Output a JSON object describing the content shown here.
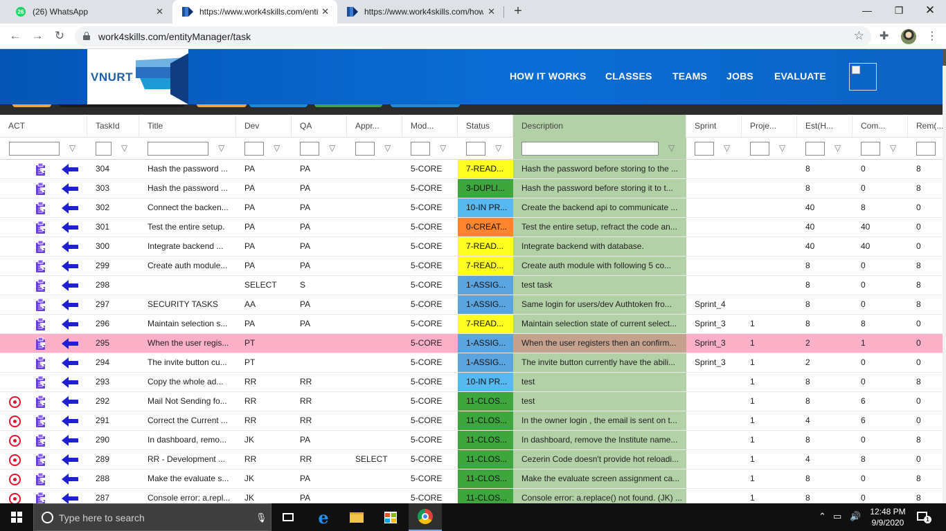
{
  "browser": {
    "tabs": [
      {
        "title": "(26) WhatsApp",
        "badge": "26",
        "icon": "whatsapp-icon",
        "active": false
      },
      {
        "title": "https://www.work4skills.com/entit",
        "icon": "work4skills-icon",
        "active": true
      },
      {
        "title": "https://www.work4skills.com/how",
        "icon": "work4skills-icon",
        "active": false
      }
    ],
    "url": "work4skills.com/entityManager/task"
  },
  "site": {
    "logo_text": "VNURT",
    "nav": [
      "HOW IT WORKS",
      "CLASSES",
      "TEAMS",
      "JOBS",
      "EVALUATE"
    ]
  },
  "grid": {
    "columns": [
      "ACT",
      "TaskId",
      "Title",
      "Dev",
      "QA",
      "Appr...",
      "Mod...",
      "Status",
      "Description",
      "Sprint",
      "Proje...",
      "Est(H...",
      "Com...",
      "Rem(..."
    ],
    "rows": [
      {
        "red": false,
        "id": "304",
        "title": "Hash the password ...",
        "dev": "PA",
        "qa": "PA",
        "appr": "",
        "mod": "5-CORE",
        "status": "7-READ...",
        "status_color": "#ffff22",
        "desc": "Hash the password before storing to the ...",
        "sprint": "",
        "proj": "",
        "est": "8",
        "com": "0",
        "rem": "8"
      },
      {
        "red": false,
        "id": "303",
        "title": "Hash the password ...",
        "dev": "PA",
        "qa": "PA",
        "appr": "",
        "mod": "5-CORE",
        "status": "3-DUPLI...",
        "status_color": "#3da63d",
        "desc": "Hash the password before storing it to t...",
        "sprint": "",
        "proj": "",
        "est": "8",
        "com": "0",
        "rem": "8"
      },
      {
        "red": false,
        "id": "302",
        "title": "Connect the backen...",
        "dev": "PA",
        "qa": "PA",
        "appr": "",
        "mod": "5-CORE",
        "status": "10-IN PR...",
        "status_color": "#56b9f0",
        "desc": "Create the backend api to communicate ...",
        "sprint": "",
        "proj": "",
        "est": "40",
        "com": "8",
        "rem": "0"
      },
      {
        "red": false,
        "id": "301",
        "title": "Test the entire setup.",
        "dev": "PA",
        "qa": "PA",
        "appr": "",
        "mod": "5-CORE",
        "status": "0-CREAT...",
        "status_color": "#ff8630",
        "desc": "Test the entire setup, refract the code an...",
        "sprint": "",
        "proj": "",
        "est": "40",
        "com": "40",
        "rem": "0"
      },
      {
        "red": false,
        "id": "300",
        "title": "Integrate backend ...",
        "dev": "PA",
        "qa": "PA",
        "appr": "",
        "mod": "5-CORE",
        "status": "7-READ...",
        "status_color": "#ffff22",
        "desc": "Integrate backend with database.",
        "sprint": "",
        "proj": "",
        "est": "40",
        "com": "40",
        "rem": "0"
      },
      {
        "red": false,
        "id": "299",
        "title": "Create auth module...",
        "dev": "PA",
        "qa": "PA",
        "appr": "",
        "mod": "5-CORE",
        "status": "7-READ...",
        "status_color": "#ffff22",
        "desc": "Create auth module with following 5 co...",
        "sprint": "",
        "proj": "",
        "est": "8",
        "com": "0",
        "rem": "8"
      },
      {
        "red": false,
        "id": "298",
        "title": "",
        "dev": "SELECT",
        "qa": "S",
        "appr": "",
        "mod": "5-CORE",
        "status": "1-ASSIG...",
        "status_color": "#5aa4e0",
        "desc": "test task",
        "sprint": "",
        "proj": "",
        "est": "8",
        "com": "0",
        "rem": "8"
      },
      {
        "red": false,
        "id": "297",
        "title": "SECURITY TASKS",
        "dev": "AA",
        "qa": "PA",
        "appr": "",
        "mod": "5-CORE",
        "status": "1-ASSIG...",
        "status_color": "#5aa4e0",
        "desc": "Same login for users/dev Authtoken fro...",
        "sprint": "Sprint_4",
        "proj": "",
        "est": "8",
        "com": "0",
        "rem": "8"
      },
      {
        "red": false,
        "id": "296",
        "title": "Maintain selection s...",
        "dev": "PA",
        "qa": "PA",
        "appr": "",
        "mod": "5-CORE",
        "status": "7-READ...",
        "status_color": "#ffff22",
        "desc": "Maintain selection state of current select...",
        "sprint": "Sprint_3",
        "proj": "1",
        "est": "8",
        "com": "8",
        "rem": "0"
      },
      {
        "red": false,
        "selected": true,
        "id": "295",
        "title": "When the user regis...",
        "dev": "PT",
        "qa": "",
        "appr": "",
        "mod": "5-CORE",
        "status": "1-ASSIG...",
        "status_color": "#5aa4e0",
        "desc": "When the user registers then an confirm...",
        "sprint": "Sprint_3",
        "proj": "1",
        "est": "2",
        "com": "1",
        "rem": "0"
      },
      {
        "red": false,
        "id": "294",
        "title": "The invite button cu...",
        "dev": "PT",
        "qa": "",
        "appr": "",
        "mod": "5-CORE",
        "status": "1-ASSIG...",
        "status_color": "#5aa4e0",
        "desc": "The invite button currently have the abili...",
        "sprint": "Sprint_3",
        "proj": "1",
        "est": "2",
        "com": "0",
        "rem": "0"
      },
      {
        "red": false,
        "id": "293",
        "title": "Copy the whole ad...",
        "dev": "RR",
        "qa": "RR",
        "appr": "",
        "mod": "5-CORE",
        "status": "10-IN PR...",
        "status_color": "#56b9f0",
        "desc": "test",
        "sprint": "",
        "proj": "1",
        "est": "8",
        "com": "0",
        "rem": "8"
      },
      {
        "red": true,
        "id": "292",
        "title": "Mail Not Sending fo...",
        "dev": "RR",
        "qa": "RR",
        "appr": "",
        "mod": "5-CORE",
        "status": "11-CLOS...",
        "status_color": "#3da63d",
        "desc": "test",
        "sprint": "",
        "proj": "1",
        "est": "8",
        "com": "6",
        "rem": "0"
      },
      {
        "red": true,
        "id": "291",
        "title": "Correct the Current ...",
        "dev": "RR",
        "qa": "RR",
        "appr": "",
        "mod": "5-CORE",
        "status": "11-CLOS...",
        "status_color": "#3da63d",
        "desc": "In the owner login , the email is sent on t...",
        "sprint": "",
        "proj": "1",
        "est": "4",
        "com": "6",
        "rem": "0"
      },
      {
        "red": true,
        "id": "290",
        "title": "In dashboard, remo...",
        "dev": "JK",
        "qa": "PA",
        "appr": "",
        "mod": "5-CORE",
        "status": "11-CLOS...",
        "status_color": "#3da63d",
        "desc": "In dashboard, remove the Institute name...",
        "sprint": "",
        "proj": "1",
        "est": "8",
        "com": "0",
        "rem": "8"
      },
      {
        "red": true,
        "id": "289",
        "title": "RR - Development ...",
        "dev": "RR",
        "qa": "RR",
        "appr": "SELECT",
        "mod": "5-CORE",
        "status": "11-CLOS...",
        "status_color": "#3da63d",
        "desc": "Cezerin Code doesn't provide hot reloadi...",
        "sprint": "",
        "proj": "1",
        "est": "4",
        "com": "8",
        "rem": "0"
      },
      {
        "red": true,
        "id": "288",
        "title": "Make the evaluate s...",
        "dev": "JK",
        "qa": "PA",
        "appr": "",
        "mod": "5-CORE",
        "status": "11-CLOS...",
        "status_color": "#3da63d",
        "desc": "Make the evaluate screen assignment ca...",
        "sprint": "",
        "proj": "1",
        "est": "8",
        "com": "0",
        "rem": "8"
      },
      {
        "red": true,
        "id": "287",
        "title": "Console error: a.repl...",
        "dev": "JK",
        "qa": "PA",
        "appr": "",
        "mod": "5-CORE",
        "status": "11-CLOS...",
        "status_color": "#3da63d",
        "desc": "Console error: a.replace() not found. (JK) ...",
        "sprint": "",
        "proj": "1",
        "est": "8",
        "com": "0",
        "rem": "8"
      }
    ]
  },
  "taskbar": {
    "search_placeholder": "Type here to search",
    "time": "12:48 PM",
    "date": "9/9/2020",
    "notifications": "1"
  }
}
